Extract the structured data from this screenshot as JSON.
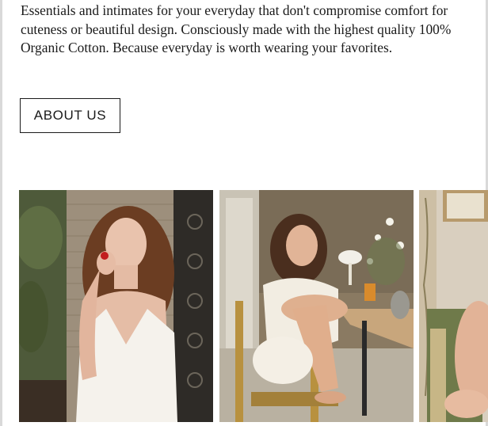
{
  "intro": {
    "text": "Essentials and intimates for your everyday that don't compromise comfort for cuteness or beautiful design. Consciously made with the highest quality 100% Organic Cotton. Because everyday is worth wearing your favorites."
  },
  "about_button": {
    "label": "ABOUT US"
  },
  "gallery": {
    "photos": [
      {
        "name": "woman-with-strawberry-photo"
      },
      {
        "name": "woman-on-chair-photo"
      },
      {
        "name": "woman-on-armchair-photo"
      }
    ]
  },
  "colors": {
    "text": "#1a1a1a",
    "button_border": "#1a1a1a",
    "background": "#ffffff"
  }
}
